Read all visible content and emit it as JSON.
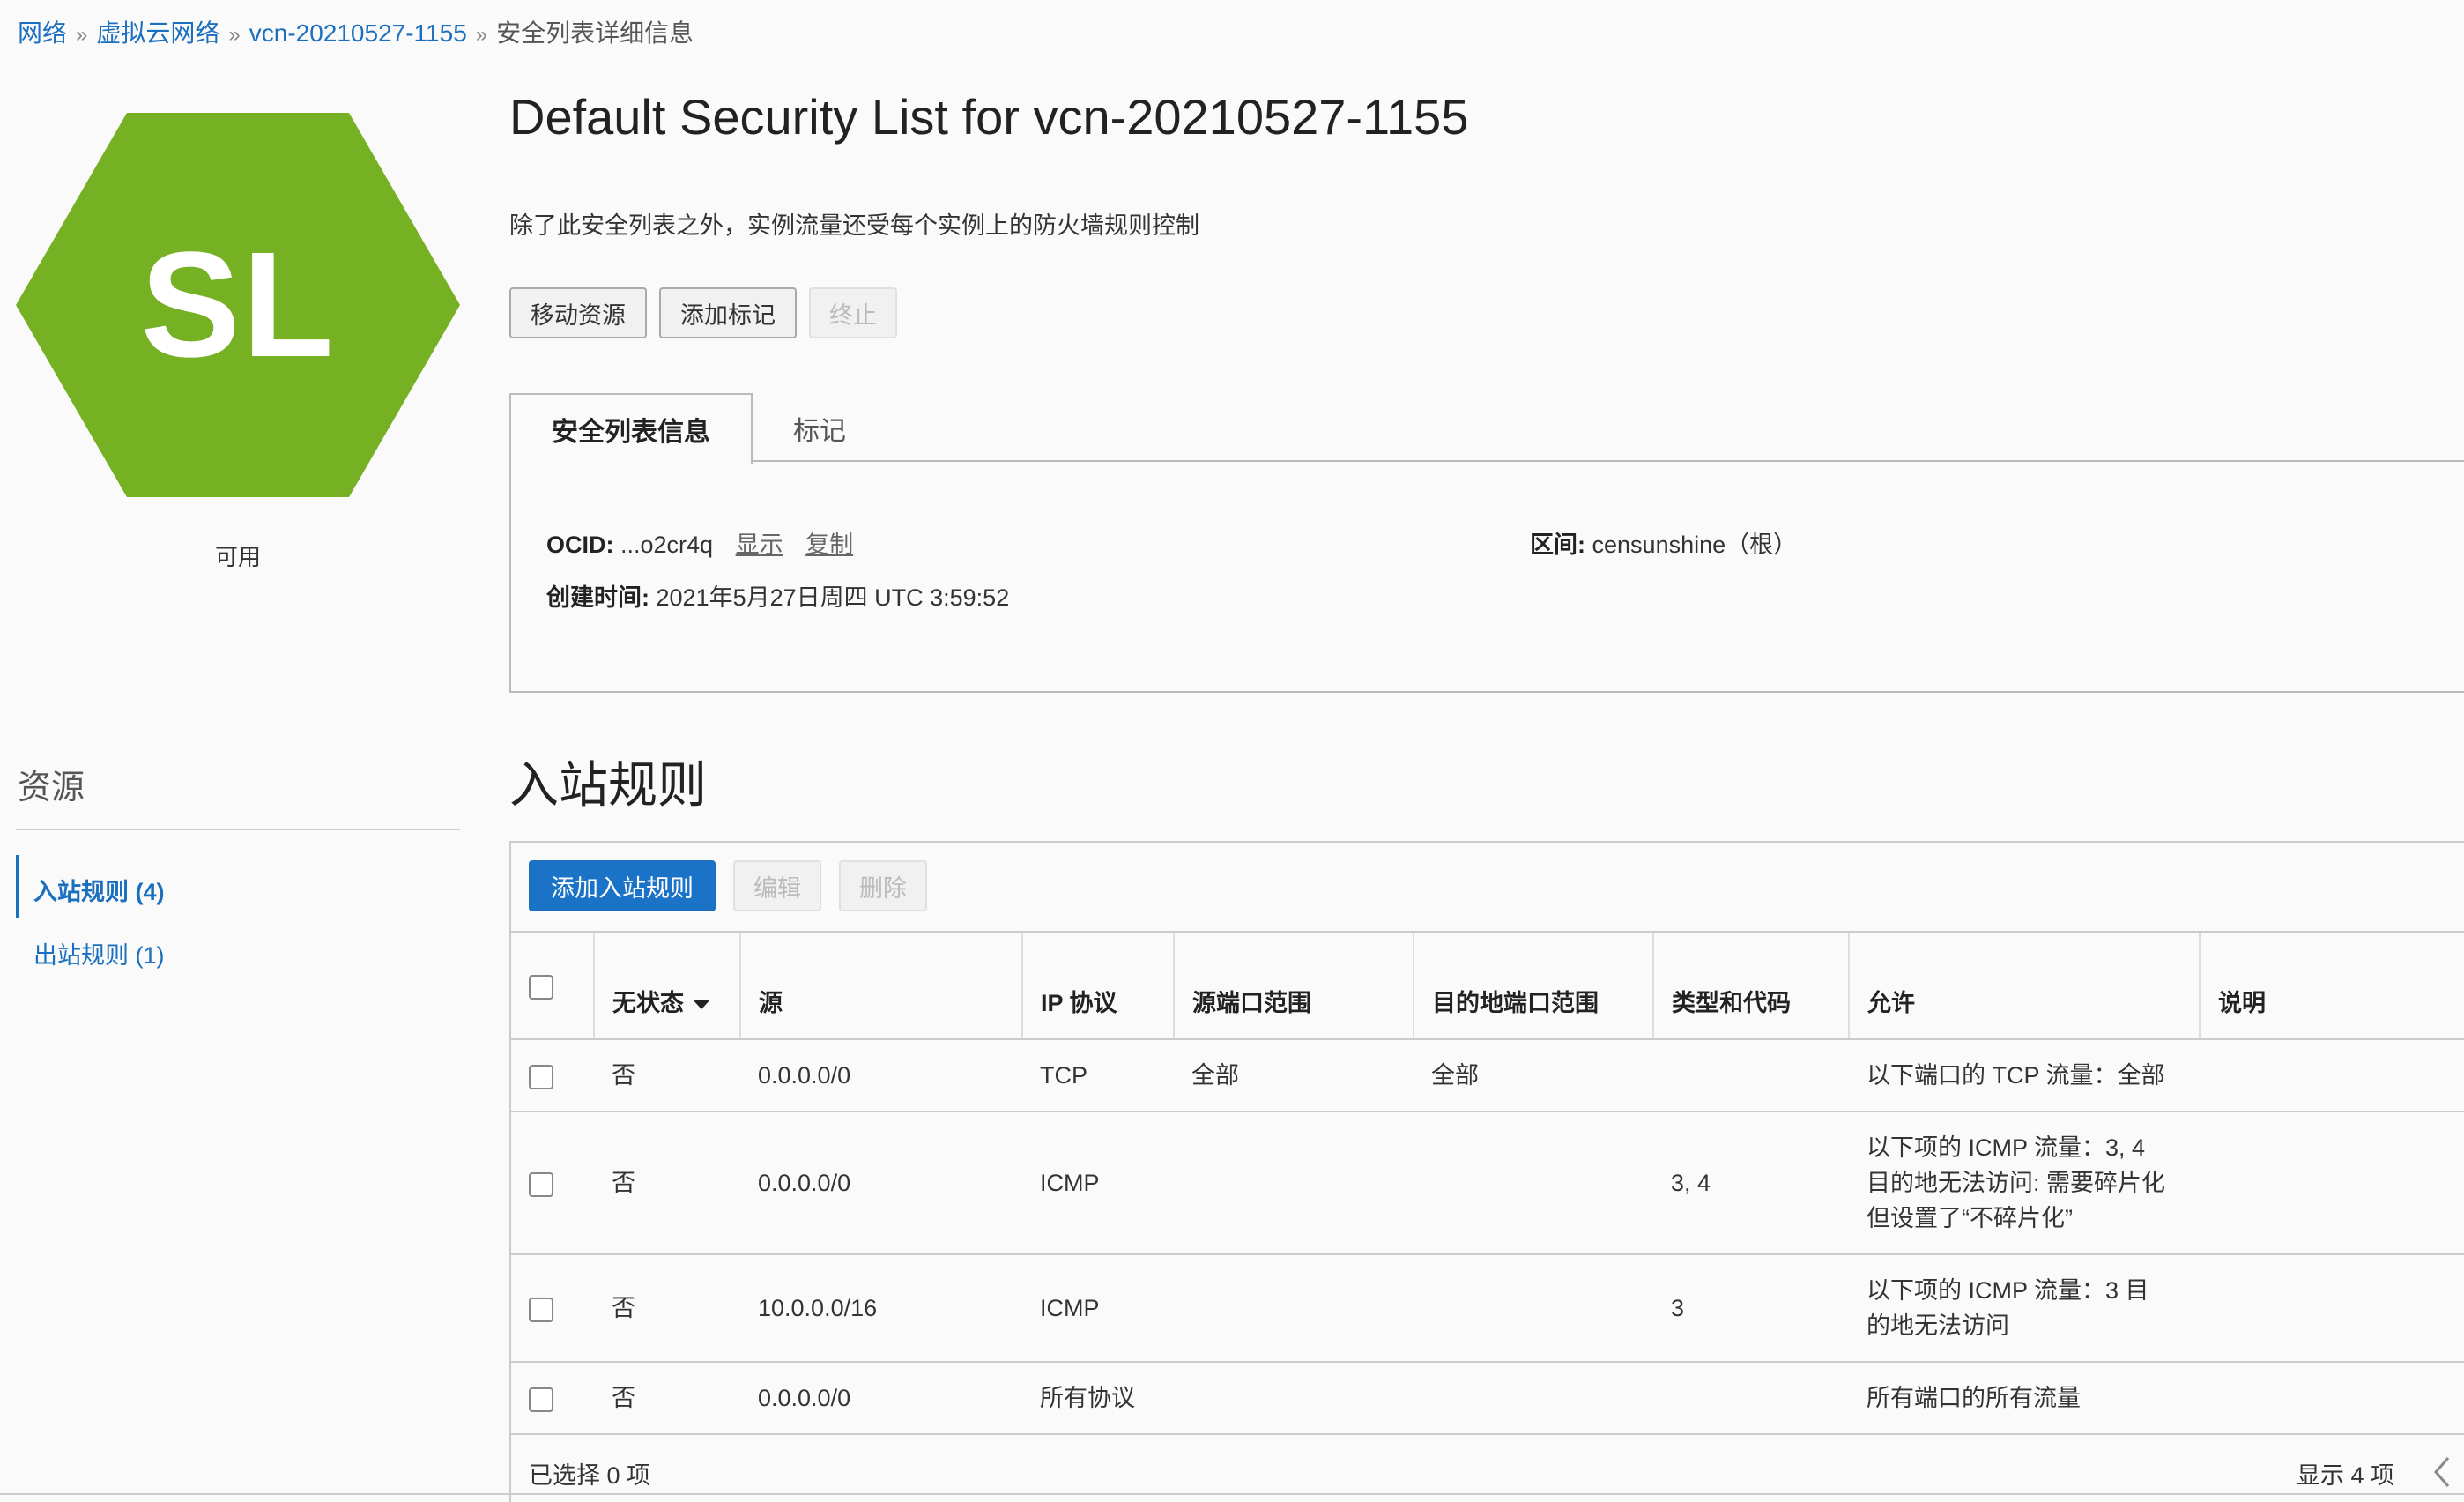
{
  "breadcrumb": {
    "items": [
      "网络",
      "虚拟云网络",
      "vcn-20210527-1155"
    ],
    "separator": "»",
    "current": "安全列表详细信息"
  },
  "resource_icon": {
    "text": "SL",
    "color": "#76b023"
  },
  "status": "可用",
  "header": {
    "title": "Default Security List for vcn-20210527-1155",
    "description": "除了此安全列表之外，实例流量还受每个实例上的防火墙规则控制"
  },
  "actions": {
    "move": "移动资源",
    "tag": "添加标记",
    "terminate": "终止"
  },
  "tabs": {
    "info": "安全列表信息",
    "tags": "标记"
  },
  "info": {
    "ocid_label": "OCID:",
    "ocid_value": "...o2cr4q",
    "show": "显示",
    "copy": "复制",
    "compartment_label": "区间:",
    "compartment_value": "censunshine（根）",
    "created_label": "创建时间:",
    "created_value": "2021年5月27日周四 UTC 3:59:52"
  },
  "sidebar": {
    "title": "资源",
    "items": [
      {
        "label": "入站规则 (4)",
        "active": true
      },
      {
        "label": "出站规则 (1)",
        "active": false
      }
    ]
  },
  "ingress": {
    "title": "入站规则",
    "add_button": "添加入站规则",
    "edit_button": "编辑",
    "delete_button": "删除",
    "columns": [
      "无状态",
      "源",
      "IP 协议",
      "源端口范围",
      "目的地端口范围",
      "类型和代码",
      "允许",
      "说明"
    ],
    "rows": [
      {
        "stateless": "否",
        "source": "0.0.0.0/0",
        "protocol": "TCP",
        "src_port": "全部",
        "dst_port": "全部",
        "type_code": "",
        "allows": [
          "以下端口的 TCP 流量：全部"
        ],
        "desc": ""
      },
      {
        "stateless": "否",
        "source": "0.0.0.0/0",
        "protocol": "ICMP",
        "src_port": "",
        "dst_port": "",
        "type_code": "3, 4",
        "allows": [
          "以下项的 ICMP 流量：3, 4",
          "目的地无法访问: 需要碎片化",
          "但设置了“不碎片化”"
        ],
        "desc": ""
      },
      {
        "stateless": "否",
        "source": "10.0.0.0/16",
        "protocol": "ICMP",
        "src_port": "",
        "dst_port": "",
        "type_code": "3",
        "allows": [
          "以下项的 ICMP 流量：3 目",
          "的地无法访问"
        ],
        "desc": ""
      },
      {
        "stateless": "否",
        "source": "0.0.0.0/0",
        "protocol": "所有协议",
        "src_port": "",
        "dst_port": "",
        "type_code": "",
        "allows": [
          "所有端口的所有流量"
        ],
        "desc": ""
      }
    ],
    "selected_text": "已选择 0 项",
    "showing_text": "显示 4 项"
  }
}
